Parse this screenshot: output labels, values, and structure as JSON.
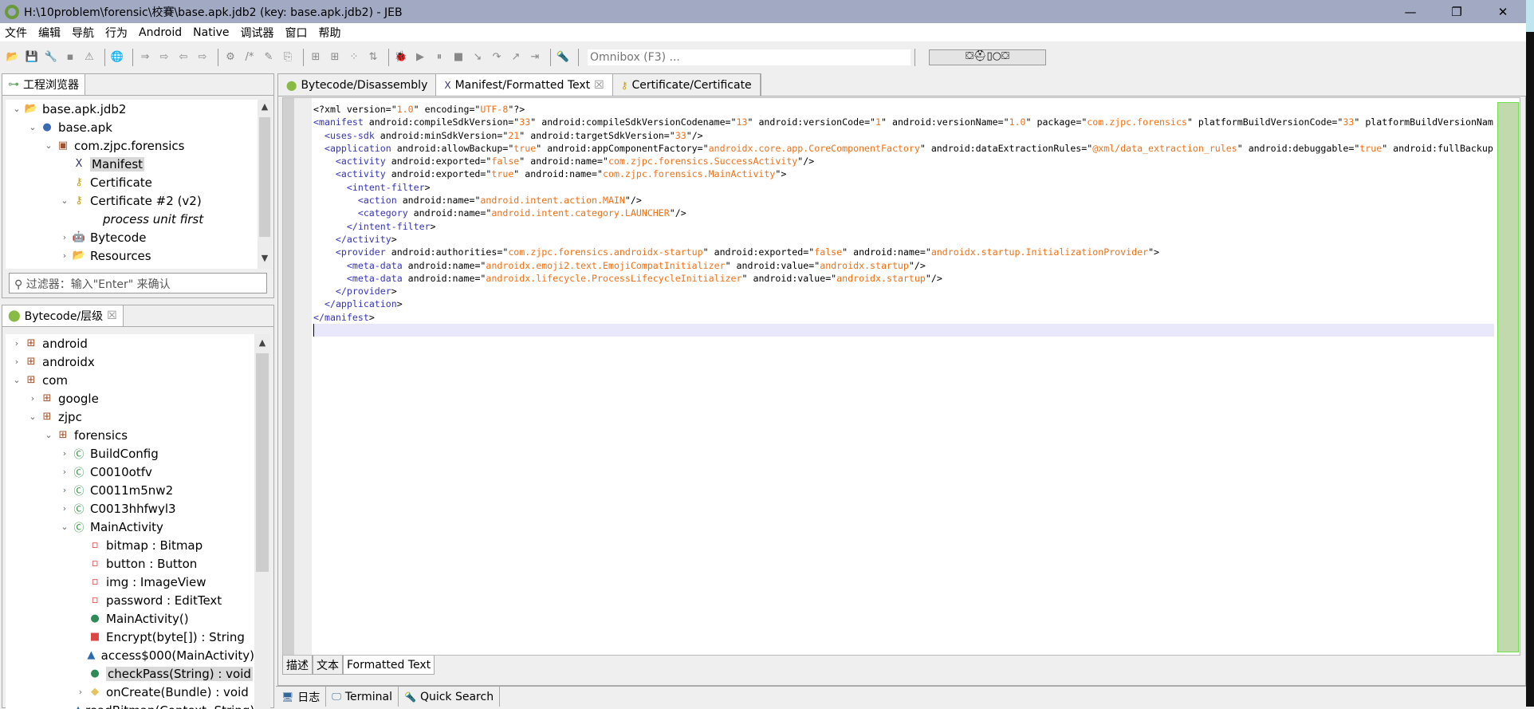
{
  "window": {
    "title": "H:\\10problem\\forensic\\校賽\\base.apk.jdb2 (key: base.apk.jdb2) - JEB",
    "minimize": "—",
    "restore": "❐",
    "close": "✕"
  },
  "menu": [
    "文件",
    "编辑",
    "导航",
    "行为",
    "Android",
    "Native",
    "调试器",
    "窗口",
    "帮助"
  ],
  "toolbar": {
    "icons": [
      "open-folder",
      "save",
      "wrench",
      "window",
      "warning",
      "globe",
      "import",
      "export",
      "back",
      "forward",
      "refactor",
      "comment",
      "edit",
      "convert",
      "graph1",
      "graph2",
      "graph3",
      "graph4",
      "debug",
      "run",
      "pause",
      "stop",
      "step-into",
      "step-over",
      "step-out",
      "run-to",
      "search-tool"
    ],
    "omnibox_placeholder": "Omnibox (F3) ...",
    "perspectives": "⛋⛑▯○⛋"
  },
  "project_explorer": {
    "tab": "工程浏览器",
    "items": [
      {
        "label": "base.apk.jdb2",
        "level": 0,
        "twisty": "v",
        "icon": "folder-open-icon",
        "glyph": "📂"
      },
      {
        "label": "base.apk",
        "level": 1,
        "twisty": "v",
        "icon": "apk-icon",
        "glyph": "●"
      },
      {
        "label": "com.zjpc.forensics",
        "level": 2,
        "twisty": "v",
        "icon": "package-icon",
        "glyph": "▣"
      },
      {
        "label": "Manifest",
        "level": 3,
        "twisty": "",
        "icon": "xml-icon",
        "glyph": "X",
        "selected": true
      },
      {
        "label": "Certificate",
        "level": 3,
        "twisty": "",
        "icon": "key-icon",
        "glyph": "⚷"
      },
      {
        "label": "Certificate #2 (v2)",
        "level": 3,
        "twisty": "v",
        "icon": "key-icon",
        "glyph": "⚷"
      },
      {
        "label": "process unit first",
        "level": 5,
        "twisty": "",
        "icon": "",
        "glyph": "",
        "italic": true
      },
      {
        "label": "Bytecode",
        "level": 3,
        "twisty": ">",
        "icon": "android-icon",
        "glyph": "🤖"
      },
      {
        "label": "Resources",
        "level": 3,
        "twisty": ">",
        "icon": "folder-icon",
        "glyph": "📂"
      }
    ],
    "filter_placeholder": "过滤器：输入\"Enter\" 来确认"
  },
  "hierarchy": {
    "tab": "Bytecode/层级",
    "items": [
      {
        "label": "android",
        "level": 0,
        "twisty": ">",
        "icon": "package-icon"
      },
      {
        "label": "androidx",
        "level": 0,
        "twisty": ">",
        "icon": "package-icon"
      },
      {
        "label": "com",
        "level": 0,
        "twisty": "v",
        "icon": "package-icon"
      },
      {
        "label": "google",
        "level": 1,
        "twisty": ">",
        "icon": "package-icon"
      },
      {
        "label": "zjpc",
        "level": 1,
        "twisty": "v",
        "icon": "package-icon"
      },
      {
        "label": "forensics",
        "level": 2,
        "twisty": "v",
        "icon": "package-icon"
      },
      {
        "label": "BuildConfig",
        "level": 3,
        "twisty": ">",
        "icon": "class-icon"
      },
      {
        "label": "C0010otfv",
        "level": 3,
        "twisty": ">",
        "icon": "class-icon"
      },
      {
        "label": "C0011m5nw2",
        "level": 3,
        "twisty": ">",
        "icon": "class-icon"
      },
      {
        "label": "C0013hhfwyl3",
        "level": 3,
        "twisty": ">",
        "icon": "class-icon"
      },
      {
        "label": "MainActivity",
        "level": 3,
        "twisty": "v",
        "icon": "class-icon"
      },
      {
        "label": "bitmap : Bitmap",
        "level": 4,
        "twisty": "",
        "icon": "private-field-icon"
      },
      {
        "label": "button : Button",
        "level": 4,
        "twisty": "",
        "icon": "private-field-icon"
      },
      {
        "label": "img : ImageView",
        "level": 4,
        "twisty": "",
        "icon": "private-field-icon"
      },
      {
        "label": "password : EditText",
        "level": 4,
        "twisty": "",
        "icon": "private-field-icon"
      },
      {
        "label": "MainActivity()",
        "level": 4,
        "twisty": "",
        "icon": "constructor-icon"
      },
      {
        "label": "Encrypt(byte[]) : String",
        "level": 4,
        "twisty": "",
        "icon": "private-method-icon"
      },
      {
        "label": "access$000(MainActivity)",
        "level": 4,
        "twisty": "",
        "icon": "static-method-icon"
      },
      {
        "label": "checkPass(String) : void",
        "level": 4,
        "twisty": "",
        "icon": "public-method-icon",
        "selected": true
      },
      {
        "label": "onCreate(Bundle) : void",
        "level": 4,
        "twisty": ">",
        "icon": "protected-method-icon"
      },
      {
        "label": "readBitmap(Context, String)",
        "level": 4,
        "twisty": "",
        "icon": "static-method-icon"
      }
    ]
  },
  "editor_tabs": [
    {
      "label": "Bytecode/Disassembly",
      "icon": "android-icon"
    },
    {
      "label": "Manifest/Formatted Text",
      "icon": "xml-icon",
      "active": true,
      "close": "☒"
    },
    {
      "label": "Certificate/Certificate",
      "icon": "key-icon"
    }
  ],
  "code_lines": [
    "<?xml version=\"1.0\" encoding=\"UTF-8\"?>",
    "<manifest android:compileSdkVersion=\"33\" android:compileSdkVersionCodename=\"13\" android:versionCode=\"1\" android:versionName=\"1.0\" package=\"com.zjpc.forensics\" platformBuildVersionCode=\"33\" platformBuildVersionNam",
    "  <uses-sdk android:minSdkVersion=\"21\" android:targetSdkVersion=\"33\"/>",
    "  <application android:allowBackup=\"true\" android:appComponentFactory=\"androidx.core.app.CoreComponentFactory\" android:dataExtractionRules=\"@xml/data_extraction_rules\" android:debuggable=\"true\" android:fullBackup",
    "    <activity android:exported=\"false\" android:name=\"com.zjpc.forensics.SuccessActivity\"/>",
    "    <activity android:exported=\"true\" android:name=\"com.zjpc.forensics.MainActivity\">",
    "      <intent-filter>",
    "        <action android:name=\"android.intent.action.MAIN\"/>",
    "        <category android:name=\"android.intent.category.LAUNCHER\"/>",
    "      </intent-filter>",
    "    </activity>",
    "    <provider android:authorities=\"com.zjpc.forensics.androidx-startup\" android:exported=\"false\" android:name=\"androidx.startup.InitializationProvider\">",
    "      <meta-data android:name=\"androidx.emoji2.text.EmojiCompatInitializer\" android:value=\"androidx.startup\"/>",
    "      <meta-data android:name=\"androidx.lifecycle.ProcessLifecycleInitializer\" android:value=\"androidx.startup\"/>",
    "    </provider>",
    "  </application>",
    "</manifest>",
    ""
  ],
  "colors": {
    "tag": "#3535b5",
    "value": "#f07015",
    "overview": "#c2d9ae"
  },
  "bottom_tabs": [
    "描述",
    "文本",
    "Formatted Text"
  ],
  "status_tabs": [
    {
      "label": "日志",
      "icon": "console-icon"
    },
    {
      "label": "Terminal",
      "icon": "terminal-icon"
    },
    {
      "label": "Quick Search",
      "icon": "search-tool-icon"
    }
  ]
}
